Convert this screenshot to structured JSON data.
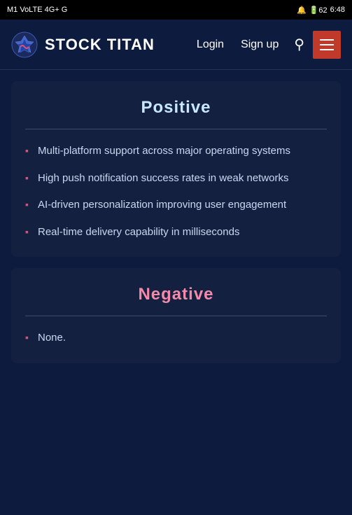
{
  "statusBar": {
    "left": "M1 VoLTE 4G+ G",
    "right": "6:48"
  },
  "navbar": {
    "brand": "STOCK TITAN",
    "loginLabel": "Login",
    "signupLabel": "Sign up",
    "searchAriaLabel": "Search",
    "menuAriaLabel": "Menu"
  },
  "positiveCard": {
    "title": "Positive",
    "items": [
      "Multi-platform support across major operating systems",
      "High push notification success rates in weak networks",
      "AI-driven personalization improving user engagement",
      "Real-time delivery capability in milliseconds"
    ]
  },
  "negativeCard": {
    "title": "Negative",
    "items": [
      "None."
    ]
  }
}
